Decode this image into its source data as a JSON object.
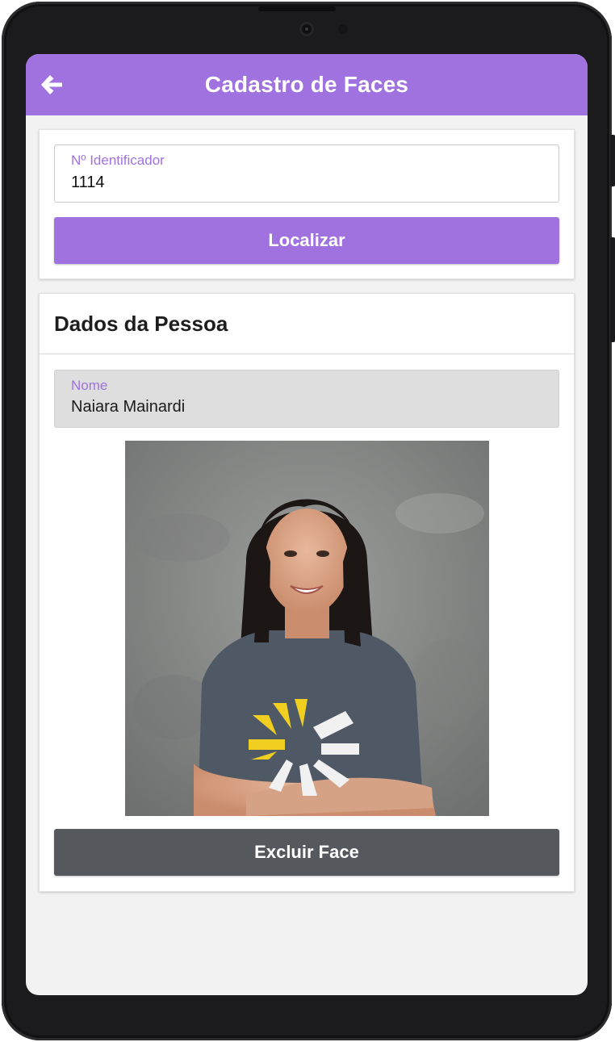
{
  "app": {
    "title": "Cadastro de Faces"
  },
  "search": {
    "id_label": "Nº Identificador",
    "id_value": "1114",
    "button_label": "Localizar"
  },
  "person": {
    "section_title": "Dados da Pessoa",
    "name_label": "Nome",
    "name_value": "Naiara Mainardi",
    "delete_button_label": "Excluir Face"
  },
  "icons": {
    "back": "arrow-left-icon"
  },
  "colors": {
    "accent": "#9f72e0",
    "danger_button": "#55585d",
    "background": "#f2f2f2"
  }
}
